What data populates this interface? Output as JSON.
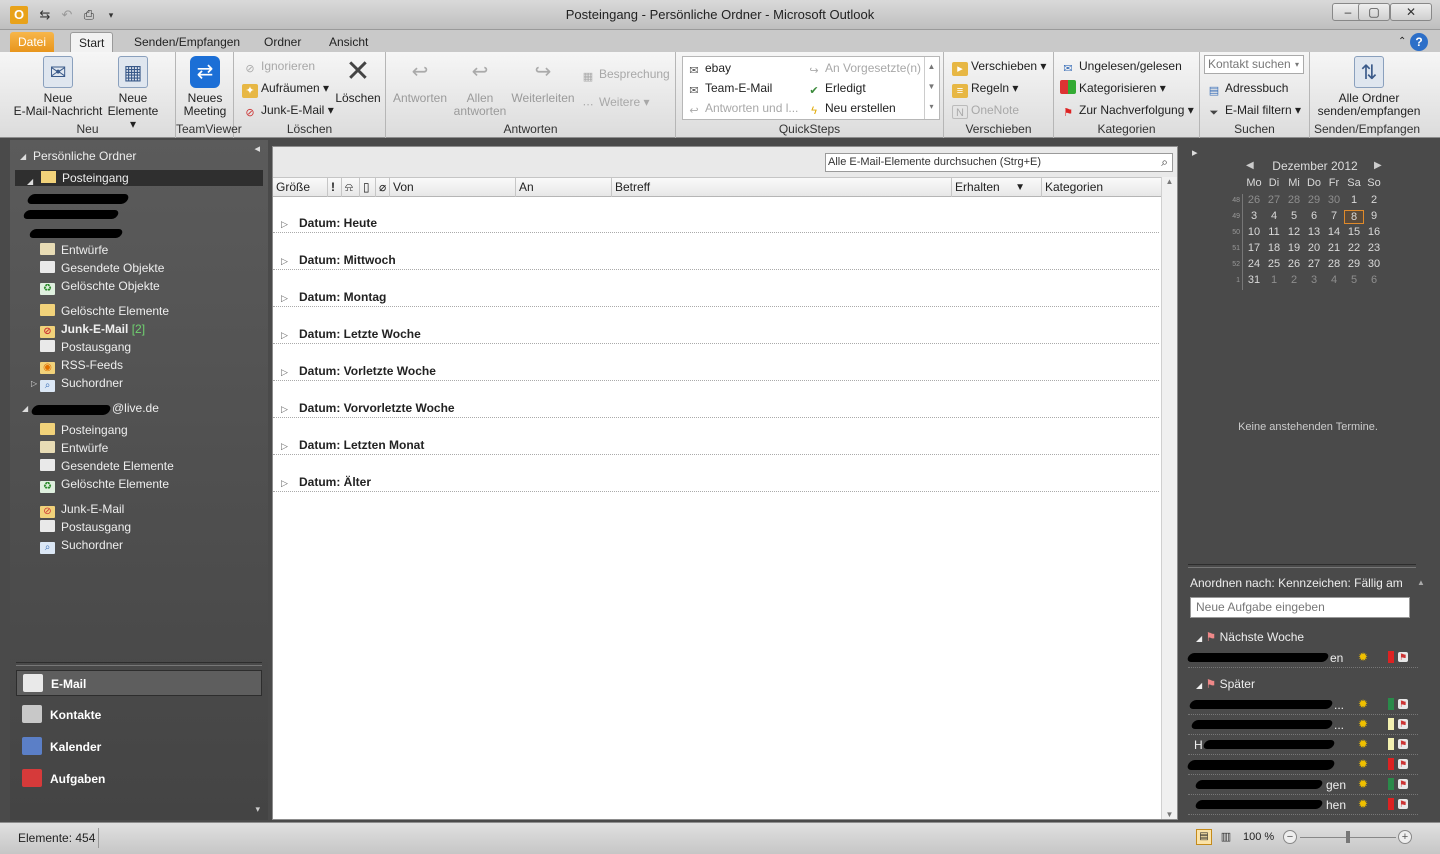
{
  "window": {
    "title": "Posteingang - Persönliche Ordner - Microsoft Outlook",
    "app_icon": "outlook-logo",
    "controls": [
      "minimize",
      "maximize",
      "close"
    ]
  },
  "tabs": [
    {
      "label": "Datei",
      "style": "file"
    },
    {
      "label": "Start",
      "active": true
    },
    {
      "label": "Senden/Empfangen"
    },
    {
      "label": "Ordner"
    },
    {
      "label": "Ansicht"
    }
  ],
  "ribbon": {
    "groups": {
      "neu": "Neu",
      "teamviewer": "TeamViewer",
      "loeschen": "Löschen",
      "antworten": "Antworten",
      "quicksteps": "QuickSteps",
      "verschieben": "Verschieben",
      "kategorien": "Kategorien",
      "suchen": "Suchen",
      "sendrecv": "Senden/Empfangen"
    },
    "neue_email": [
      "Neue",
      "E-Mail-Nachricht"
    ],
    "neue_elemente": [
      "Neue",
      "Elemente"
    ],
    "neues_meeting": [
      "Neues",
      "Meeting"
    ],
    "ignorieren": "Ignorieren",
    "aufraeumen": "Aufräumen",
    "junk": "Junk-E-Mail",
    "loeschen_btn": "Löschen",
    "antworten_btn": "Antworten",
    "allen_antworten": [
      "Allen",
      "antworten"
    ],
    "weiterleiten": "Weiterleiten",
    "besprechung": "Besprechung",
    "weitere": "Weitere",
    "qs_ebay": "ebay",
    "qs_team": "Team-E-Mail",
    "qs_antworten": "Antworten und l...",
    "qs_vorgesetzte": "An Vorgesetzte(n)",
    "qs_erledigt": "Erledigt",
    "qs_neu": "Neu erstellen",
    "verschieben_btn": "Verschieben",
    "regeln": "Regeln",
    "onenote": "OneNote",
    "ungelesen": "Ungelesen/gelesen",
    "kategorisieren": "Kategorisieren",
    "nachverfolgung": "Zur Nachverfolgung",
    "kontakt_suchen": "Kontakt suchen",
    "adressbuch": "Adressbuch",
    "email_filtern": "E-Mail filtern",
    "alle_ordner": [
      "Alle Ordner",
      "senden/empfangen"
    ]
  },
  "nav": {
    "root1": "Persönliche Ordner",
    "folders1": [
      {
        "label": "Posteingang",
        "selected": true
      },
      {
        "label": "Entwürfe"
      },
      {
        "label": "Gesendete Objekte"
      },
      {
        "label": "Gelöschte Objekte"
      },
      {
        "label": "Gelöschte Elemente"
      },
      {
        "label": "Junk-E-Mail",
        "count": "[2]"
      },
      {
        "label": "Postausgang"
      },
      {
        "label": "RSS-Feeds"
      },
      {
        "label": "Suchordner"
      }
    ],
    "root2_suffix": "@live.de",
    "folders2": [
      {
        "label": "Posteingang"
      },
      {
        "label": "Entwürfe"
      },
      {
        "label": "Gesendete Elemente"
      },
      {
        "label": "Gelöschte Elemente"
      },
      {
        "label": "Junk-E-Mail"
      },
      {
        "label": "Postausgang"
      },
      {
        "label": "Suchordner"
      }
    ],
    "modules": [
      {
        "label": "E-Mail",
        "active": true,
        "color": "#e9e9e9"
      },
      {
        "label": "Kontakte",
        "color": "#c8c8c8"
      },
      {
        "label": "Kalender",
        "color": "#5b7fc7"
      },
      {
        "label": "Aufgaben",
        "color": "#d63a3a"
      }
    ]
  },
  "mail": {
    "search_placeholder": "Alle E-Mail-Elemente durchsuchen (Strg+E)",
    "columns": {
      "groesse": "Größe",
      "wichtigkeit": "!",
      "von": "Von",
      "an": "An",
      "betreff": "Betreff",
      "erhalten": "Erhalten",
      "kategorien": "Kategorien"
    },
    "groups": [
      "Datum: Heute",
      "Datum: Mittwoch",
      "Datum: Montag",
      "Datum: Letzte Woche",
      "Datum: Vorletzte Woche",
      "Datum: Vorvorletzte Woche",
      "Datum: Letzten Monat",
      "Datum: Älter"
    ]
  },
  "todo": {
    "month": "Dezember 2012",
    "weekdays": [
      "Mo",
      "Di",
      "Mi",
      "Do",
      "Fr",
      "Sa",
      "So"
    ],
    "weeks": [
      {
        "wk": "48",
        "days": [
          "26",
          "27",
          "28",
          "29",
          "30",
          "1",
          "2"
        ]
      },
      {
        "wk": "49",
        "days": [
          "3",
          "4",
          "5",
          "6",
          "7",
          "8",
          "9"
        ]
      },
      {
        "wk": "50",
        "days": [
          "10",
          "11",
          "12",
          "13",
          "14",
          "15",
          "16"
        ]
      },
      {
        "wk": "51",
        "days": [
          "17",
          "18",
          "19",
          "20",
          "21",
          "22",
          "23"
        ]
      },
      {
        "wk": "52",
        "days": [
          "24",
          "25",
          "26",
          "27",
          "28",
          "29",
          "30"
        ]
      },
      {
        "wk": "1",
        "days": [
          "31",
          "1",
          "2",
          "3",
          "4",
          "5",
          "6"
        ]
      }
    ],
    "today": "8",
    "no_appointments": "Keine anstehenden Termine.",
    "arrange_by": "Anordnen nach: Kennzeichen: Fällig am",
    "new_task_placeholder": "Neue Aufgabe eingeben",
    "section1": "Nächste Woche",
    "section2": "Später",
    "tasks1": [
      {
        "visible_text": "en",
        "cat": "#d22"
      }
    ],
    "tasks2": [
      {
        "visible_text": "...",
        "cat": "#2a8a4a"
      },
      {
        "visible_text": "...",
        "cat": "#f3f0b0"
      },
      {
        "visible_text": "H",
        "cat": "#f3f0b0"
      },
      {
        "visible_text": "",
        "cat": "#d22"
      },
      {
        "visible_text": "gen",
        "cat": "#2a8a4a"
      },
      {
        "visible_text": "hen",
        "cat": "#d22"
      }
    ]
  },
  "status": {
    "elements": "Elemente: 454",
    "zoom": "100 %"
  }
}
